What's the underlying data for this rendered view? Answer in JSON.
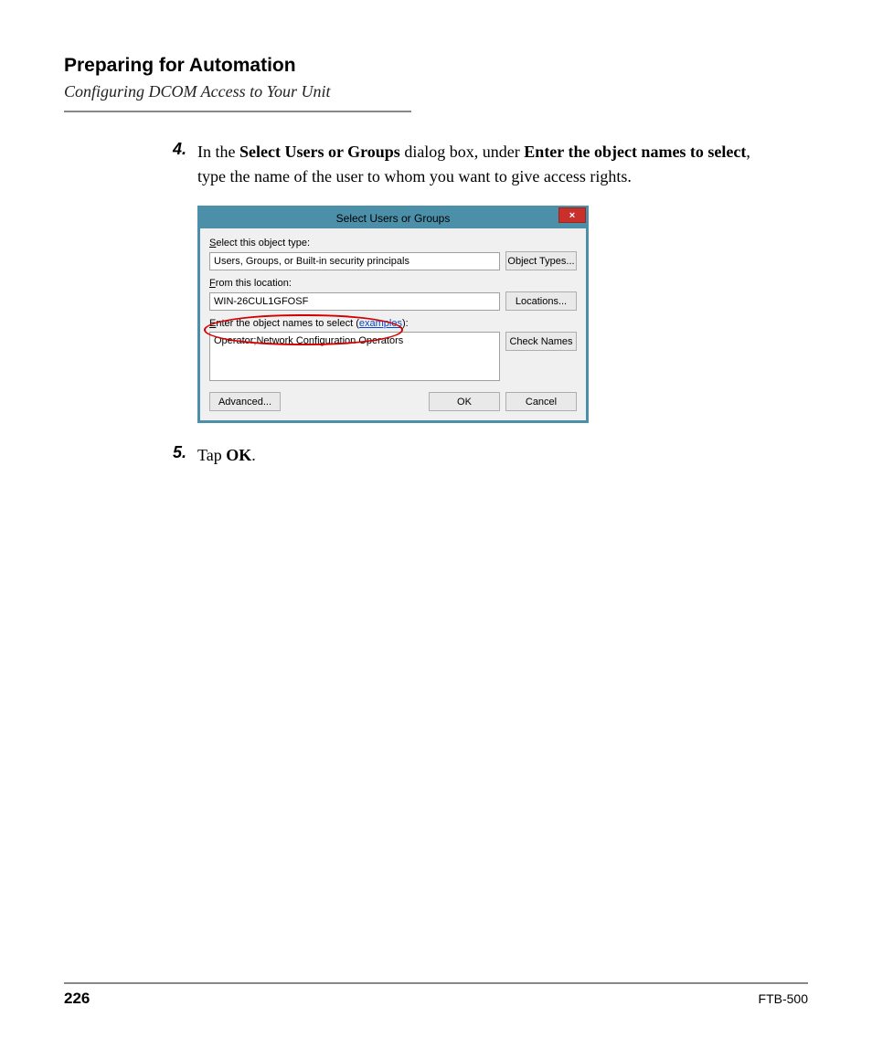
{
  "header": {
    "title": "Preparing for Automation",
    "subtitle": "Configuring DCOM Access to Your Unit"
  },
  "steps": {
    "s4": {
      "num": "4.",
      "t1": "In the ",
      "b1": "Select Users or Groups",
      "t2": " dialog box, under ",
      "b2": "Enter the object names to select",
      "t3": ", type the name of the user to whom you want to give access rights."
    },
    "s5": {
      "num": "5.",
      "t1": "Tap ",
      "b1": "OK",
      "t2": "."
    }
  },
  "dialog": {
    "title": "Select Users or Groups",
    "close": "×",
    "object_type_label": "Select this object type:",
    "object_type_value": "Users, Groups, or Built-in security principals",
    "object_types_btn": "Object Types...",
    "location_label": "From this location:",
    "location_value": "WIN-26CUL1GFOSF",
    "locations_btn": "Locations...",
    "names_label_pre": "Enter the object names to select ",
    "names_label_paren_open": "(",
    "names_label_link": "examples",
    "names_label_paren_close": "):",
    "names_value": "Operator;Network Configuration Operators",
    "check_names_btn": "Check Names",
    "advanced_btn": "Advanced...",
    "ok_btn": "OK",
    "cancel_btn": "Cancel"
  },
  "footer": {
    "page": "226",
    "docid": "FTB-500"
  }
}
